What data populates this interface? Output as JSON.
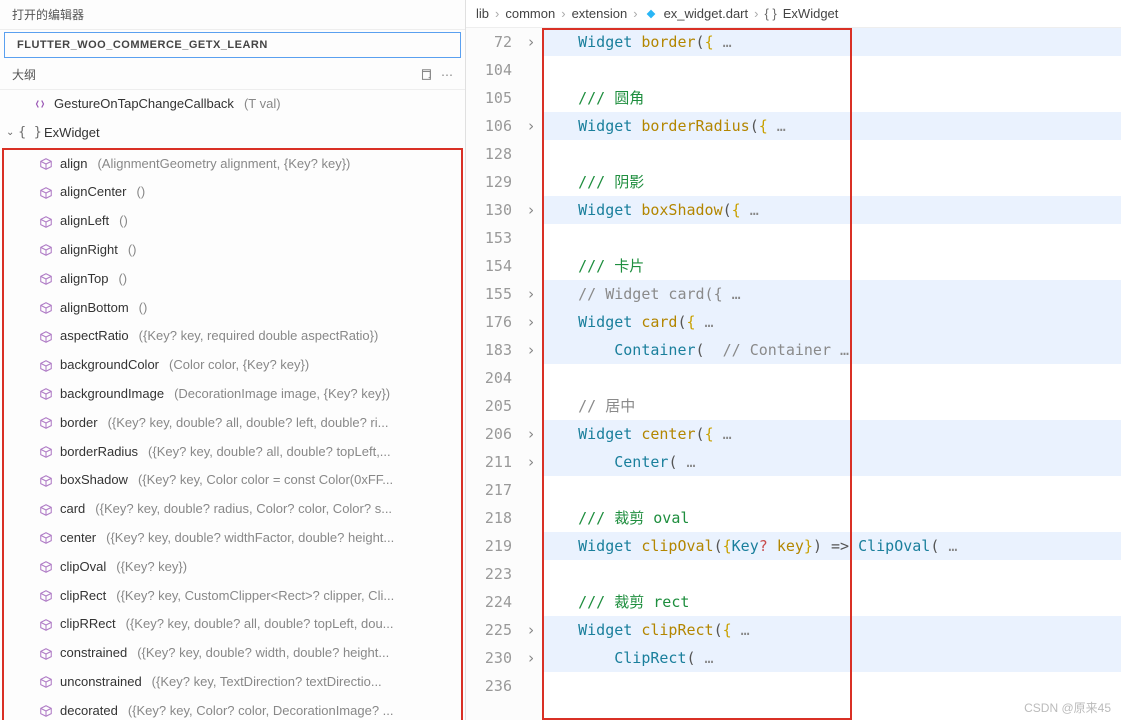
{
  "sidebar": {
    "header_label": "打开的编辑器",
    "project_title": "FLUTTER_WOO_COMMERCE_GETX_LEARN",
    "outline_label": "大纲",
    "items": [
      {
        "level": 2,
        "icon": "callback",
        "name": "GestureOnTapChangeCallback",
        "params": "(T val)",
        "chevron": ""
      },
      {
        "level": 1,
        "icon": "braces",
        "name": "ExWidget",
        "params": "",
        "chevron": "down"
      }
    ],
    "methods": [
      {
        "name": "align",
        "params": "(AlignmentGeometry alignment, {Key? key})"
      },
      {
        "name": "alignCenter",
        "params": "()"
      },
      {
        "name": "alignLeft",
        "params": "()"
      },
      {
        "name": "alignRight",
        "params": "()"
      },
      {
        "name": "alignTop",
        "params": "()"
      },
      {
        "name": "alignBottom",
        "params": "()"
      },
      {
        "name": "aspectRatio",
        "params": "({Key? key, required double aspectRatio})"
      },
      {
        "name": "backgroundColor",
        "params": "(Color color, {Key? key})"
      },
      {
        "name": "backgroundImage",
        "params": "(DecorationImage image, {Key? key})"
      },
      {
        "name": "border",
        "params": "({Key? key, double? all, double? left, double? ri..."
      },
      {
        "name": "borderRadius",
        "params": "({Key? key, double? all, double? topLeft,..."
      },
      {
        "name": "boxShadow",
        "params": "({Key? key, Color color = const Color(0xFF..."
      },
      {
        "name": "card",
        "params": "({Key? key, double? radius, Color? color, Color? s..."
      },
      {
        "name": "center",
        "params": "({Key? key, double? widthFactor, double? height..."
      },
      {
        "name": "clipOval",
        "params": "({Key? key})"
      },
      {
        "name": "clipRect",
        "params": "({Key? key, CustomClipper<Rect>? clipper, Cli..."
      },
      {
        "name": "clipRRect",
        "params": "({Key? key, double? all, double? topLeft, dou..."
      },
      {
        "name": "constrained",
        "params": "({Key? key, double? width, double? height..."
      },
      {
        "name": "unconstrained",
        "params": "({Key? key, TextDirection? textDirectio..."
      },
      {
        "name": "decorated",
        "params": "({Key? key, Color? color, DecorationImage? ..."
      }
    ]
  },
  "editor": {
    "breadcrumbs": [
      "lib",
      "common",
      "extension",
      "ex_widget.dart",
      "ExWidget"
    ],
    "lines": [
      {
        "ln": "72",
        "fold": ">",
        "hl": true,
        "tokens": [
          [
            "ind",
            "    "
          ],
          [
            "type",
            "Widget"
          ],
          [
            "punc",
            " "
          ],
          [
            "method",
            "border"
          ],
          [
            "punc",
            "("
          ],
          [
            "brace-y",
            "{"
          ],
          [
            "dots",
            " …"
          ]
        ]
      },
      {
        "ln": "104",
        "fold": "",
        "hl": false,
        "tokens": []
      },
      {
        "ln": "105",
        "fold": "",
        "hl": false,
        "tokens": [
          [
            "ind",
            "    "
          ],
          [
            "comment",
            "/// 圆角"
          ]
        ]
      },
      {
        "ln": "106",
        "fold": ">",
        "hl": true,
        "tokens": [
          [
            "ind",
            "    "
          ],
          [
            "type",
            "Widget"
          ],
          [
            "punc",
            " "
          ],
          [
            "method",
            "borderRadius"
          ],
          [
            "punc",
            "("
          ],
          [
            "brace-y",
            "{"
          ],
          [
            "dots",
            " …"
          ]
        ]
      },
      {
        "ln": "128",
        "fold": "",
        "hl": false,
        "tokens": []
      },
      {
        "ln": "129",
        "fold": "",
        "hl": false,
        "tokens": [
          [
            "ind",
            "    "
          ],
          [
            "comment",
            "/// 阴影"
          ]
        ]
      },
      {
        "ln": "130",
        "fold": ">",
        "hl": true,
        "tokens": [
          [
            "ind",
            "    "
          ],
          [
            "type",
            "Widget"
          ],
          [
            "punc",
            " "
          ],
          [
            "method",
            "boxShadow"
          ],
          [
            "punc",
            "("
          ],
          [
            "brace-y",
            "{"
          ],
          [
            "dots",
            " …"
          ]
        ]
      },
      {
        "ln": "153",
        "fold": "",
        "hl": false,
        "tokens": []
      },
      {
        "ln": "154",
        "fold": "",
        "hl": false,
        "tokens": [
          [
            "ind",
            "    "
          ],
          [
            "comment",
            "/// 卡片"
          ]
        ]
      },
      {
        "ln": "155",
        "fold": ">",
        "hl": true,
        "tokens": [
          [
            "ind",
            "    "
          ],
          [
            "gray-comment",
            "// Widget card({"
          ],
          [
            "dots",
            " …"
          ]
        ]
      },
      {
        "ln": "176",
        "fold": ">",
        "hl": true,
        "tokens": [
          [
            "ind",
            "    "
          ],
          [
            "type",
            "Widget"
          ],
          [
            "punc",
            " "
          ],
          [
            "method",
            "card"
          ],
          [
            "punc",
            "("
          ],
          [
            "brace-y",
            "{"
          ],
          [
            "dots",
            " …"
          ]
        ]
      },
      {
        "ln": "183",
        "fold": ">",
        "hl": true,
        "tokens": [
          [
            "ind",
            "        "
          ],
          [
            "type",
            "Container"
          ],
          [
            "punc",
            "("
          ],
          [
            "gray-comment",
            "  // Container"
          ],
          [
            "dots",
            " …"
          ]
        ]
      },
      {
        "ln": "204",
        "fold": "",
        "hl": false,
        "tokens": []
      },
      {
        "ln": "205",
        "fold": "",
        "hl": false,
        "tokens": [
          [
            "ind",
            "    "
          ],
          [
            "gray-comment",
            "// 居中"
          ]
        ]
      },
      {
        "ln": "206",
        "fold": ">",
        "hl": true,
        "tokens": [
          [
            "ind",
            "    "
          ],
          [
            "type",
            "Widget"
          ],
          [
            "punc",
            " "
          ],
          [
            "method",
            "center"
          ],
          [
            "punc",
            "("
          ],
          [
            "brace-y",
            "{"
          ],
          [
            "dots",
            " …"
          ]
        ]
      },
      {
        "ln": "211",
        "fold": ">",
        "hl": true,
        "tokens": [
          [
            "ind",
            "        "
          ],
          [
            "type",
            "Center"
          ],
          [
            "punc",
            "("
          ],
          [
            "dots",
            " …"
          ]
        ]
      },
      {
        "ln": "217",
        "fold": "",
        "hl": false,
        "tokens": []
      },
      {
        "ln": "218",
        "fold": "",
        "hl": false,
        "tokens": [
          [
            "ind",
            "    "
          ],
          [
            "comment",
            "/// 裁剪 oval"
          ]
        ]
      },
      {
        "ln": "219",
        "fold": "",
        "hl": true,
        "tokens": [
          [
            "ind",
            "    "
          ],
          [
            "type",
            "Widget"
          ],
          [
            "punc",
            " "
          ],
          [
            "method",
            "clipOval"
          ],
          [
            "punc",
            "("
          ],
          [
            "brace-y",
            "{"
          ],
          [
            "type",
            "Key"
          ],
          [
            "key",
            "?"
          ],
          [
            "punc",
            " "
          ],
          [
            "method",
            "key"
          ],
          [
            "brace-y",
            "}"
          ],
          [
            "punc",
            ") => "
          ],
          [
            "type",
            "ClipOval"
          ],
          [
            "punc",
            "("
          ],
          [
            "dots",
            " …"
          ]
        ]
      },
      {
        "ln": "223",
        "fold": "",
        "hl": false,
        "tokens": []
      },
      {
        "ln": "224",
        "fold": "",
        "hl": false,
        "tokens": [
          [
            "ind",
            "    "
          ],
          [
            "comment",
            "/// 裁剪 rect"
          ]
        ]
      },
      {
        "ln": "225",
        "fold": ">",
        "hl": true,
        "tokens": [
          [
            "ind",
            "    "
          ],
          [
            "type",
            "Widget"
          ],
          [
            "punc",
            " "
          ],
          [
            "method",
            "clipRect"
          ],
          [
            "punc",
            "("
          ],
          [
            "brace-y",
            "{"
          ],
          [
            "dots",
            " …"
          ]
        ]
      },
      {
        "ln": "230",
        "fold": ">",
        "hl": true,
        "tokens": [
          [
            "ind",
            "        "
          ],
          [
            "type",
            "ClipRect"
          ],
          [
            "punc",
            "("
          ],
          [
            "dots",
            " …"
          ]
        ]
      },
      {
        "ln": "236",
        "fold": "",
        "hl": false,
        "tokens": []
      }
    ]
  },
  "watermark": "CSDN @原来45"
}
